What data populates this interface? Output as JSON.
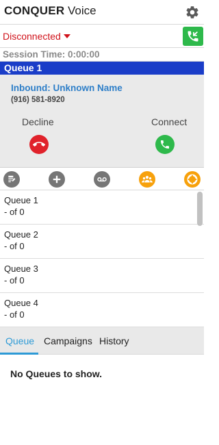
{
  "header": {
    "brand_bold": "CONQUER",
    "brand_light": " Voice",
    "settings_icon": "gear-icon"
  },
  "status": {
    "label": "Disconnected",
    "color": "#d0121a",
    "dial_icon": "incoming-call-icon",
    "dial_color": "#2eb94b"
  },
  "session": {
    "text": "Session Time: 0:00:00"
  },
  "active_queue": {
    "title": "Queue 1",
    "bar_color": "#1a3dc8"
  },
  "call": {
    "caller_name": "Inbound: Unknown Name",
    "caller_phone": "(916) 581-8920",
    "decline_label": "Decline",
    "connect_label": "Connect",
    "decline_color": "#e0222b",
    "connect_color": "#2eb94b"
  },
  "toolbar": {
    "icons": [
      "notes-icon",
      "add-icon",
      "voicemail-icon",
      "team-icon",
      "help-icon"
    ]
  },
  "queues": [
    {
      "name": "Queue 1",
      "count": "- of 0"
    },
    {
      "name": "Queue 2",
      "count": "- of 0"
    },
    {
      "name": "Queue 3",
      "count": "- of 0"
    },
    {
      "name": "Queue 4",
      "count": "- of 0"
    }
  ],
  "tabs": {
    "items": [
      "Queue",
      "Campaigns",
      "History"
    ],
    "active": "Queue",
    "accent": "#2d9ad6"
  },
  "empty": {
    "message": "No Queues to show."
  }
}
